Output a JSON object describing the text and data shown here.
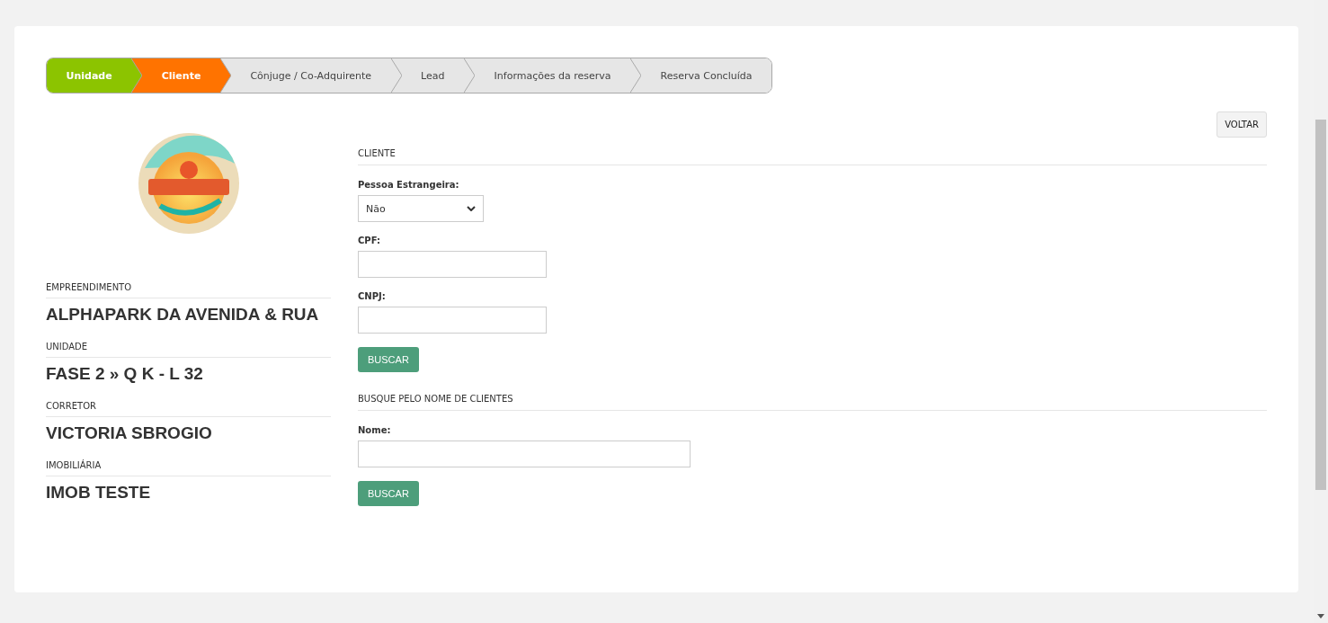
{
  "steps": [
    {
      "label": "Unidade",
      "selected": false
    },
    {
      "label": "Cliente",
      "selected": true
    },
    {
      "label": "Cônjuge / Co-Adquirente",
      "selected": false
    },
    {
      "label": "Lead",
      "selected": false
    },
    {
      "label": "Informações da reserva",
      "selected": false
    },
    {
      "label": "Reserva Concluída",
      "selected": false
    }
  ],
  "back_button": "VOLTAR",
  "summary": [
    {
      "label": "EMPREENDIMENTO",
      "value": "ALPHAPARK DA AVENIDA & RUA"
    },
    {
      "label": "UNIDADE",
      "value": "FASE 2 » Q K - L 32"
    },
    {
      "label": "CORRETOR",
      "value": "VICTORIA SBROGIO"
    },
    {
      "label": "IMOBILIÁRIA",
      "value": "IMOB TESTE"
    }
  ],
  "sections": [
    {
      "title": "CLIENTE",
      "fields": [
        {
          "kind": "select",
          "label": "Pessoa Estrangeira:",
          "value": "Não"
        },
        {
          "kind": "text",
          "label": "CPF:"
        },
        {
          "kind": "text",
          "label": "CNPJ:"
        }
      ],
      "button": "BUSCAR"
    },
    {
      "title": "BUSQUE PELO NOME DE CLIENTES",
      "fields": [
        {
          "kind": "wide",
          "label": "Nome:"
        }
      ],
      "button": "BUSCAR"
    }
  ]
}
